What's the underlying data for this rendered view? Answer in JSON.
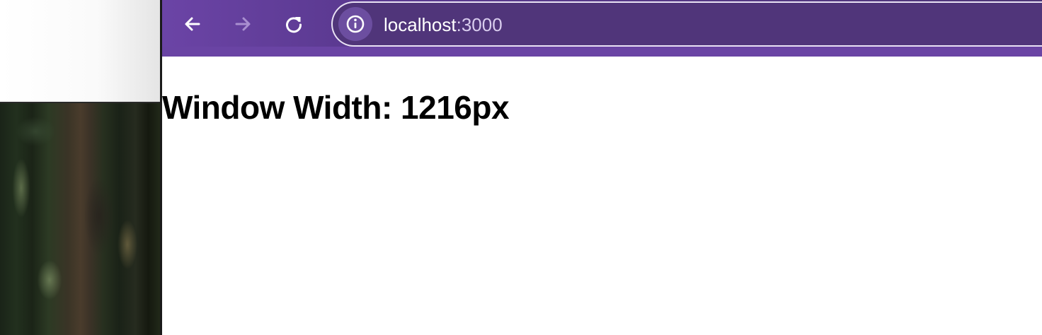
{
  "background": {
    "wallpaper": "forest-photo"
  },
  "browser": {
    "theme_color": "#5c3a92",
    "toolbar": {
      "back_icon": "arrow-left-icon",
      "forward_icon": "arrow-right-icon",
      "reload_icon": "reload-icon",
      "site_info_icon": "info-icon"
    },
    "address_bar": {
      "host": "localhost",
      "port": ":3000"
    }
  },
  "page": {
    "heading": "Window Width: 1216px"
  }
}
